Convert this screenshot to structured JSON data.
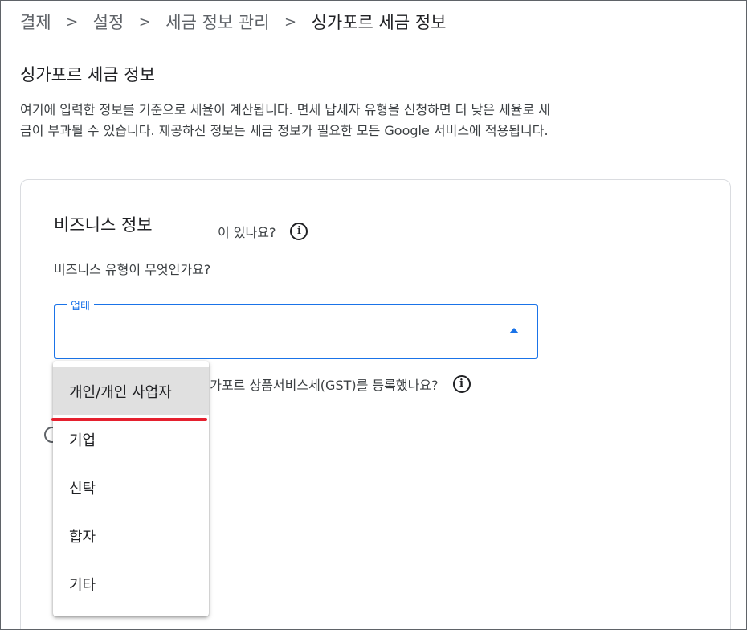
{
  "breadcrumb": {
    "items": [
      "결제",
      "설정",
      "세금 정보 관리"
    ],
    "separator": ">",
    "current": "싱가포르 세금 정보"
  },
  "page": {
    "title": "싱가포르 세금 정보",
    "description": "여기에 입력한 정보를 기준으로 세율이 계산됩니다. 면세 납세자 유형을 신청하면 더 낮은 세율로 세금이 부과될 수 있습니다. 제공하신 정보는 세금 정보가 필요한 모든 Google 서비스에 적용됩니다."
  },
  "business": {
    "title": "비즈니스 정보",
    "question_type": "비즈니스 유형이 무엇인가요?",
    "field_label": "업태",
    "field_value": "",
    "question_partial": "이 있나요?",
    "question_gst_partial": "따라 싱가포르 상품서비스세(GST)를 등록했나요?",
    "info_icon": "i"
  },
  "dropdown": {
    "options": [
      "개인/개인 사업자",
      "기업",
      "신탁",
      "합자",
      "기타"
    ],
    "highlighted_index": 0
  },
  "colors": {
    "accent": "#1a73e8",
    "highlight_bar": "#e5202e",
    "hover_bg": "#e0e0e0"
  },
  "icons": {
    "breadcrumb_separator": "chevron-right-icon",
    "dropdown_arrow": "arrow-drop-up-icon",
    "help": "info-icon"
  }
}
